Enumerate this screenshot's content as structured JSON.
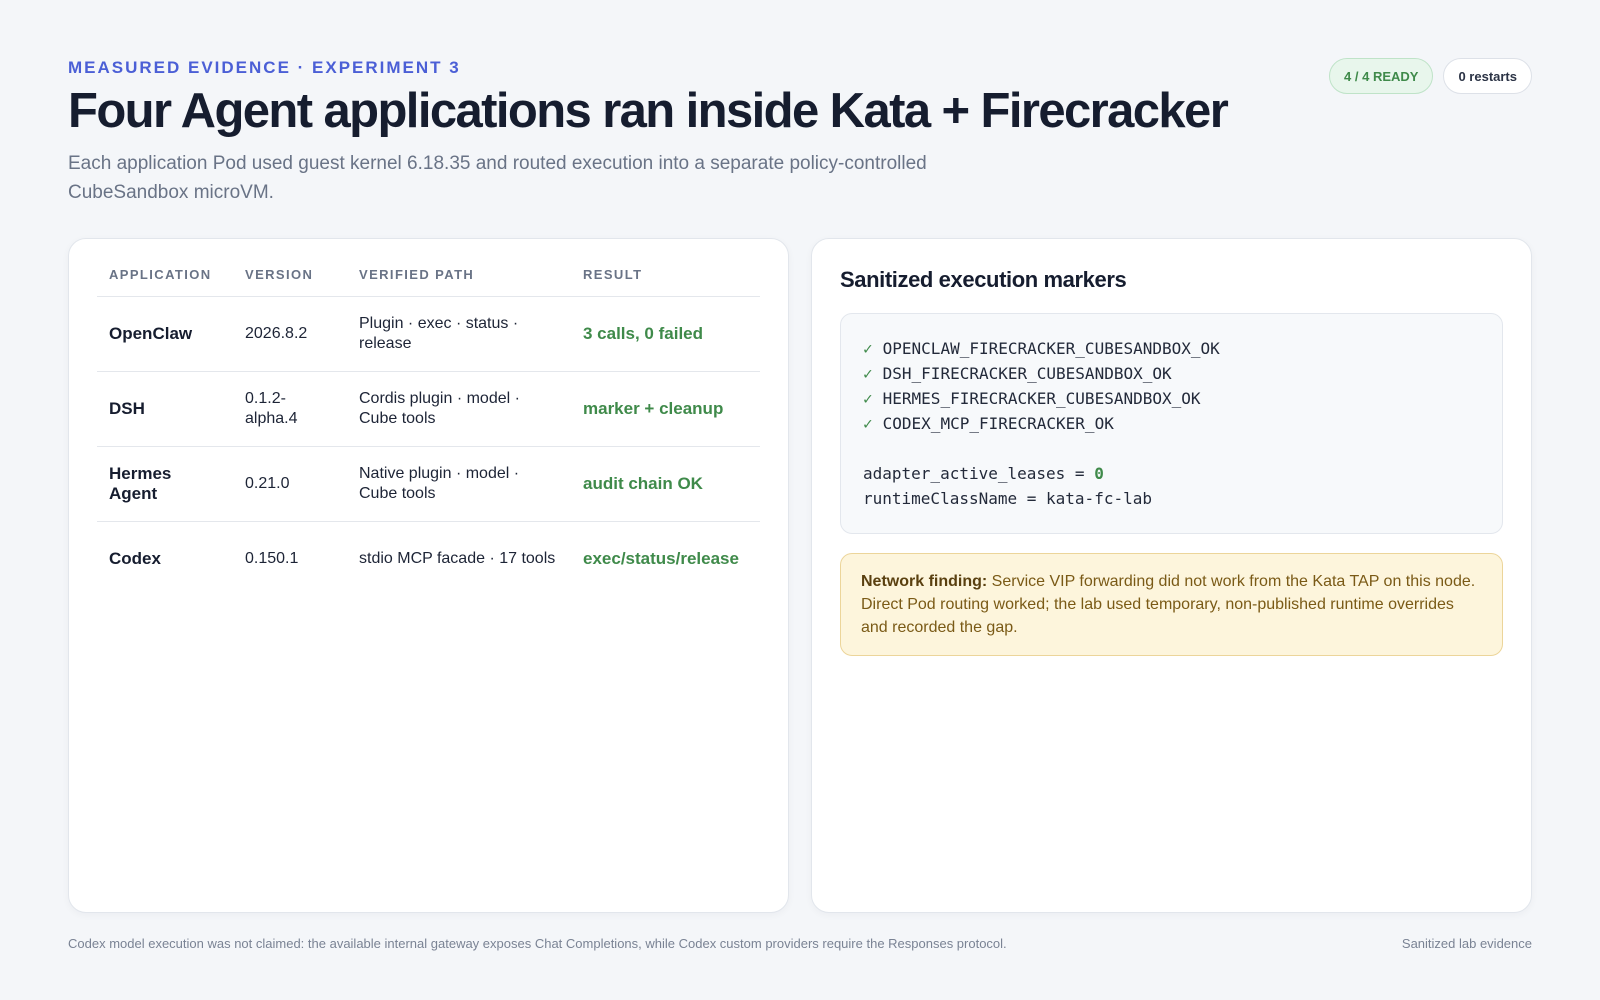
{
  "header": {
    "eyebrow": "MEASURED EVIDENCE · EXPERIMENT 3",
    "title": "Four Agent applications ran inside Kata + Firecracker",
    "subtitle": "Each application Pod used guest kernel 6.18.35 and routed execution into a separate policy-controlled CubeSandbox microVM.",
    "badges": {
      "ready": "4 / 4 READY",
      "restarts": "0 restarts"
    }
  },
  "table": {
    "headers": [
      "APPLICATION",
      "VERSION",
      "VERIFIED PATH",
      "RESULT"
    ],
    "rows": [
      {
        "application": "OpenClaw",
        "version": "2026.8.2",
        "path": "Plugin · exec · status · release",
        "result": "3 calls, 0 failed"
      },
      {
        "application": "DSH",
        "version": "0.1.2-alpha.4",
        "path": "Cordis plugin · model · Cube tools",
        "result": "marker + cleanup"
      },
      {
        "application": "Hermes Agent",
        "version": "0.21.0",
        "path": "Native plugin · model · Cube tools",
        "result": "audit chain OK"
      },
      {
        "application": "Codex",
        "version": "0.150.1",
        "path": "stdio MCP facade · 17 tools",
        "result": "exec/status/release"
      }
    ]
  },
  "markers": {
    "title": "Sanitized execution markers",
    "check_glyph": "✓",
    "items": [
      "OPENCLAW_FIRECRACKER_CUBESANDBOX_OK",
      "DSH_FIRECRACKER_CUBESANDBOX_OK",
      "HERMES_FIRECRACKER_CUBESANDBOX_OK",
      "CODEX_MCP_FIRECRACKER_OK"
    ],
    "lease_label": "adapter_active_leases = ",
    "lease_value": "0",
    "runtime_line": "runtimeClassName = kata-fc-lab"
  },
  "finding": {
    "label": "Network finding:",
    "text": " Service VIP forwarding did not work from the Kata TAP on this node. Direct Pod routing worked; the lab used temporary, non-published runtime overrides and recorded the gap."
  },
  "footer": {
    "note": "Codex model execution was not claimed: the available internal gateway exposes Chat Completions, while Codex custom providers require the Responses protocol.",
    "right": "Sanitized lab evidence"
  }
}
